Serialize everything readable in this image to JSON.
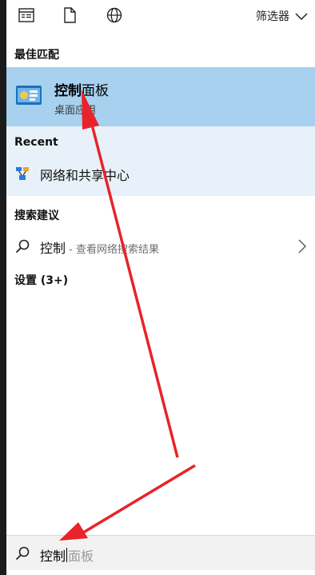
{
  "toolbar": {
    "icons": [
      "list-icon",
      "document-icon",
      "globe-icon"
    ],
    "filter_label": "筛选器"
  },
  "best_match": {
    "section_label": "最佳匹配",
    "title_bold": "控制",
    "title_rest": "面板",
    "subtitle": "桌面应用"
  },
  "recent": {
    "section_label": "Recent",
    "items": [
      {
        "label": "网络和共享中心",
        "icon": "network-icon"
      }
    ]
  },
  "suggestions": {
    "section_label": "搜索建议",
    "items": [
      {
        "query": "控制",
        "hint": " - 查看网络搜索结果"
      }
    ]
  },
  "settings": {
    "section_label": "设置 (3+)"
  },
  "search_box": {
    "typed": "控制",
    "suggestion": "面板"
  },
  "colors": {
    "selection": "#a7d1ef",
    "recent_bg": "#e8f1fa",
    "annotation": "#e8232a"
  }
}
